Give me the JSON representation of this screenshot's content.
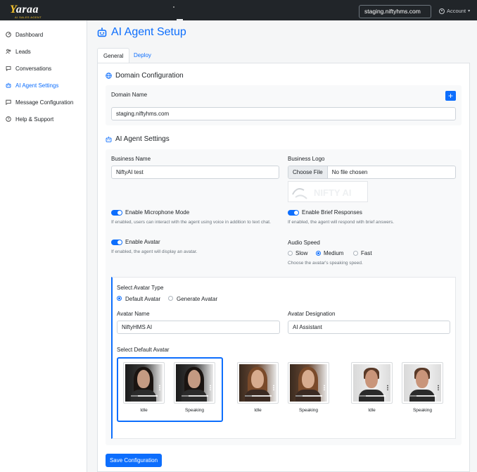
{
  "topbar": {
    "logo_text": "araa",
    "logo_subtext": "AI SALES AGENT",
    "domain": "staging.niftyhms.com",
    "account_label": "Account"
  },
  "sidebar": {
    "items": [
      {
        "label": "Dashboard",
        "icon": "dashboard-icon",
        "active": false
      },
      {
        "label": "Leads",
        "icon": "users-icon",
        "active": false
      },
      {
        "label": "Conversations",
        "icon": "chat-icon",
        "active": false
      },
      {
        "label": "AI Agent Settings",
        "icon": "robot-icon",
        "active": true
      },
      {
        "label": "Message Configuration",
        "icon": "message-icon",
        "active": false
      },
      {
        "label": "Help & Support",
        "icon": "help-icon",
        "active": false
      }
    ]
  },
  "page": {
    "title": "AI Agent Setup",
    "tabs": [
      {
        "label": "General",
        "active": true
      },
      {
        "label": "Deploy",
        "active": false
      }
    ]
  },
  "domain_config": {
    "heading": "Domain Configuration",
    "label": "Domain Name",
    "value": "staging.niftyhms.com",
    "add_label": "+"
  },
  "agent_settings": {
    "heading": "AI Agent Settings",
    "business_name_label": "Business Name",
    "business_name_value": "NiftyAI test",
    "business_logo_label": "Business Logo",
    "file_button": "Choose File",
    "file_status": "No file chosen",
    "mic_label": "Enable Microphone Mode",
    "mic_help": "If enabled, users can interact with the agent using voice in addition to text chat.",
    "mic_enabled": true,
    "brief_label": "Enable Brief Responses",
    "brief_help": "If enabled, the agent will respond with brief answers.",
    "brief_enabled": true,
    "avatar_toggle_label": "Enable Avatar",
    "avatar_toggle_help": "If enabled, the agent will display an avatar.",
    "avatar_enabled": true,
    "audio_speed_label": "Audio Speed",
    "audio_speed_options": [
      "Slow",
      "Medium",
      "Fast"
    ],
    "audio_speed_selected": "Medium",
    "audio_speed_help": "Choose the avatar's speaking speed."
  },
  "avatar": {
    "type_label": "Select Avatar Type",
    "type_options": [
      "Default Avatar",
      "Generate Avatar"
    ],
    "type_selected": "Default Avatar",
    "name_label": "Avatar Name",
    "name_value": "NiftyHMS AI",
    "designation_label": "Avatar Designation",
    "designation_value": "AI Assistant",
    "default_label": "Select Default Avatar",
    "groups": [
      {
        "idle": "Idle",
        "speaking": "Speaking",
        "selected": true
      },
      {
        "idle": "Idle",
        "speaking": "Speaking",
        "selected": false
      },
      {
        "idle": "Idle",
        "speaking": "Speaking",
        "selected": false
      }
    ]
  },
  "actions": {
    "save_label": "Save Configuration"
  },
  "colors": {
    "primary": "#0d6efd",
    "topbar": "#212529",
    "logo_accent": "#f7c42c"
  }
}
